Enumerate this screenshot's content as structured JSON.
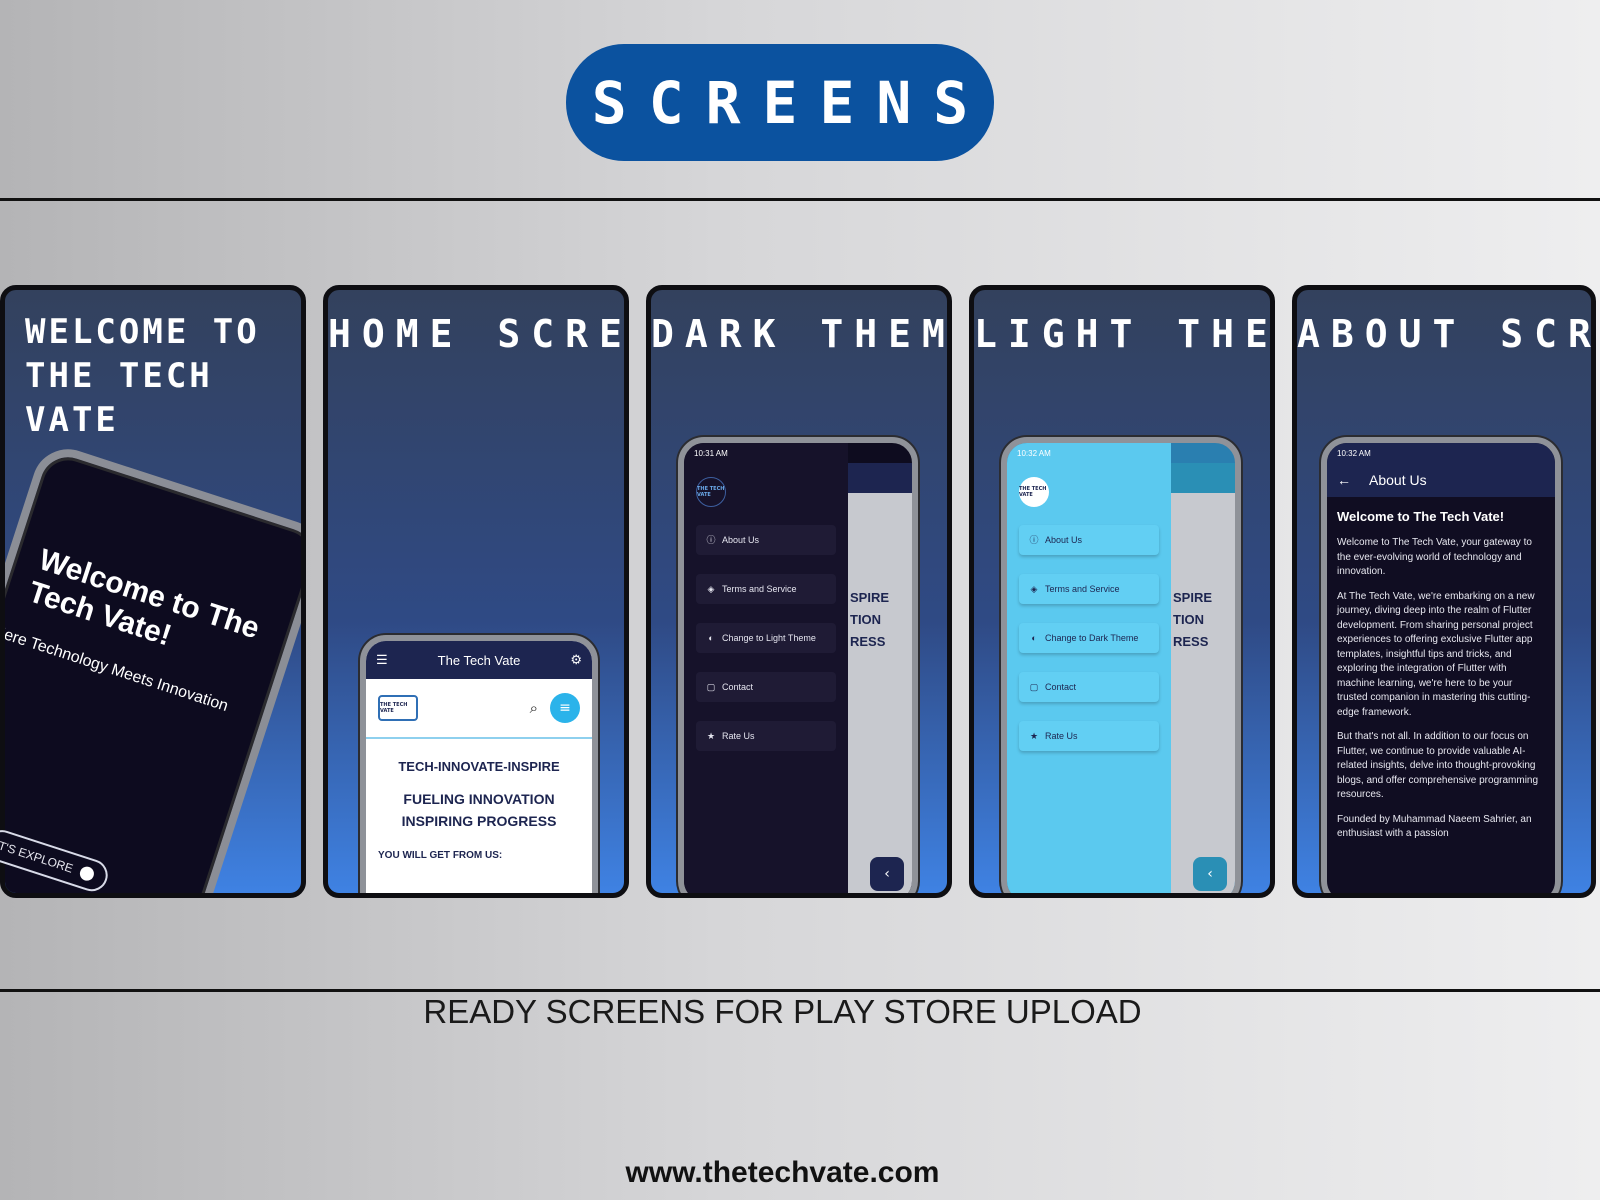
{
  "header": {
    "title": "SCREENS"
  },
  "panels": [
    {
      "title": "WELCOME TO\nTHE TECH VATE",
      "welcome_text": "Welcome to The Tech Vate!",
      "tagline": "Here Technology Meets Innovation",
      "button": "T'S EXPLORE"
    },
    {
      "title": "HOME SCREEN"
    },
    {
      "title": "DARK THEME"
    },
    {
      "title": "LIGHT THEME"
    },
    {
      "title": "ABOUT SCREEN"
    }
  ],
  "home": {
    "app_title": "The Tech Vate",
    "logo_text": "THE TECH VATE",
    "tagline": "TECH-INNOVATE-INSPIRE",
    "subtitle": "FUELING INNOVATION\nINSPIRING PROGRESS",
    "get_from": "YOU WILL GET FROM US:"
  },
  "dark": {
    "time": "10:31 AM",
    "menu": [
      "About Us",
      "Terms and Service",
      "Change to Light Theme",
      "Contact",
      "Rate Us"
    ],
    "behind_text": "SPIRE\nTION\nRESS"
  },
  "light": {
    "time": "10:32 AM",
    "menu": [
      "About Us",
      "Terms and Service",
      "Change to Dark Theme",
      "Contact",
      "Rate Us"
    ],
    "behind_text": "SPIRE\nTION\nRESS"
  },
  "about": {
    "time": "10:32 AM",
    "appbar_title": "About Us",
    "heading": "Welcome to The Tech Vate!",
    "paragraphs": [
      "Welcome to The Tech Vate, your gateway to the ever-evolving world of technology and innovation.",
      "At The Tech Vate, we're embarking on a new journey, diving deep into the realm of Flutter development. From sharing personal project experiences to offering exclusive Flutter app templates, insightful tips and tricks, and exploring the integration of Flutter with machine learning, we're here to be your trusted companion in mastering this cutting-edge framework.",
      "But that's not all. In addition to our focus on Flutter, we continue to provide valuable AI-related insights, delve into thought-provoking blogs, and offer comprehensive programming resources.",
      "Founded by Muhammad Naeem Sahrier, an enthusiast with a passion"
    ]
  },
  "footer": {
    "caption": "READY SCREENS FOR PLAY STORE UPLOAD",
    "url": "www.thetechvate.com"
  },
  "colors": {
    "accent": "#0b529f",
    "navy": "#1d2550",
    "cyan": "#5bc9ef"
  }
}
